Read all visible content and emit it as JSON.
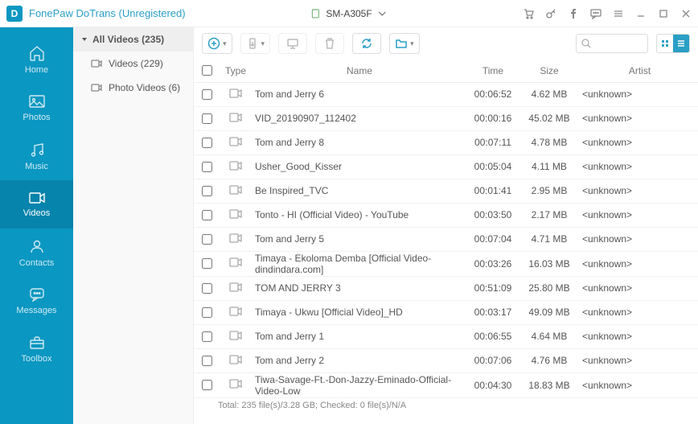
{
  "titlebar": {
    "title": "FonePaw DoTrans (Unregistered)"
  },
  "device": {
    "name": "SM-A305F"
  },
  "nav": {
    "items": [
      {
        "key": "home",
        "label": "Home"
      },
      {
        "key": "photos",
        "label": "Photos"
      },
      {
        "key": "music",
        "label": "Music"
      },
      {
        "key": "videos",
        "label": "Videos"
      },
      {
        "key": "contacts",
        "label": "Contacts"
      },
      {
        "key": "messages",
        "label": "Messages"
      },
      {
        "key": "toolbox",
        "label": "Toolbox"
      }
    ],
    "active": "videos"
  },
  "subnav": {
    "header": "All Videos (235)",
    "items": [
      {
        "key": "videos",
        "label": "Videos (229)"
      },
      {
        "key": "photo-videos",
        "label": "Photo Videos (6)"
      }
    ]
  },
  "columns": {
    "type": "Type",
    "name": "Name",
    "time": "Time",
    "size": "Size",
    "artist": "Artist"
  },
  "rows": [
    {
      "name": "Tom and Jerry 6",
      "time": "00:06:52",
      "size": "4.62 MB",
      "artist": "<unknown>"
    },
    {
      "name": "VID_20190907_112402",
      "time": "00:00:16",
      "size": "45.02 MB",
      "artist": "<unknown>"
    },
    {
      "name": "Tom and Jerry 8",
      "time": "00:07:11",
      "size": "4.78 MB",
      "artist": "<unknown>"
    },
    {
      "name": "Usher_Good_Kisser",
      "time": "00:05:04",
      "size": "4.11 MB",
      "artist": "<unknown>"
    },
    {
      "name": "Be Inspired_TVC",
      "time": "00:01:41",
      "size": "2.95 MB",
      "artist": "<unknown>"
    },
    {
      "name": "Tonto - HI (Official Video) - YouTube",
      "time": "00:03:50",
      "size": "2.17 MB",
      "artist": "<unknown>"
    },
    {
      "name": "Tom and Jerry 5",
      "time": "00:07:04",
      "size": "4.71 MB",
      "artist": "<unknown>"
    },
    {
      "name": "Timaya - Ekoloma Demba [Official Video-dindindara.com]",
      "time": "00:03:26",
      "size": "16.03 MB",
      "artist": "<unknown>"
    },
    {
      "name": "TOM AND JERRY 3",
      "time": "00:51:09",
      "size": "25.80 MB",
      "artist": "<unknown>"
    },
    {
      "name": "Timaya - Ukwu [Official Video]_HD",
      "time": "00:03:17",
      "size": "49.09 MB",
      "artist": "<unknown>"
    },
    {
      "name": "Tom and Jerry 1",
      "time": "00:06:55",
      "size": "4.64 MB",
      "artist": "<unknown>"
    },
    {
      "name": "Tom and Jerry 2",
      "time": "00:07:06",
      "size": "4.76 MB",
      "artist": "<unknown>"
    },
    {
      "name": "Tiwa-Savage-Ft.-Don-Jazzy-Eminado-Official-Video-Low",
      "time": "00:04:30",
      "size": "18.83 MB",
      "artist": "<unknown>"
    }
  ],
  "status": "Total: 235 file(s)/3.28 GB; Checked: 0 file(s)/N/A"
}
